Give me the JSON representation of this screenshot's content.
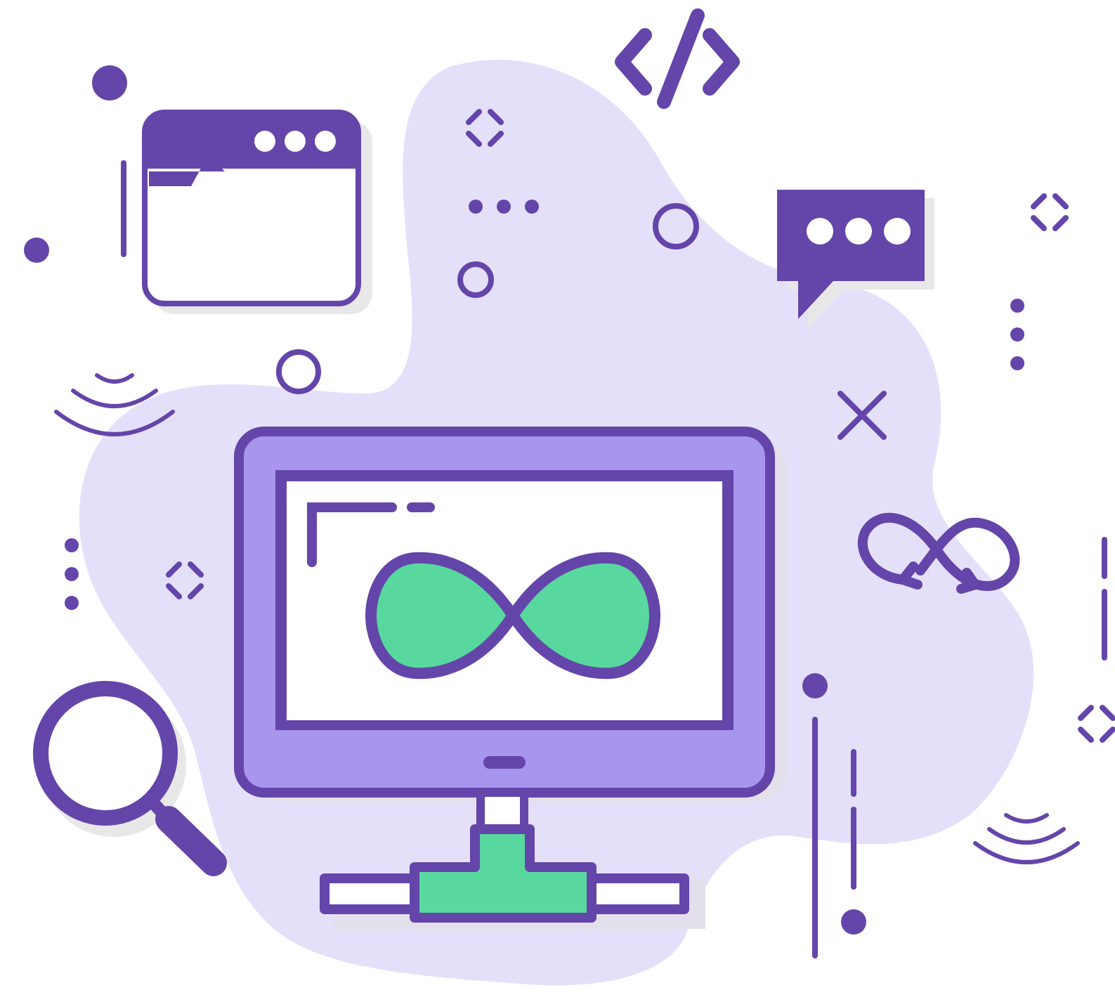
{
  "illustration": {
    "subject": "devops-infinity-monitor",
    "colors": {
      "primary": "#6445AA",
      "monitor_fill": "#A895EE",
      "blob": "#E5E0FA",
      "accent_green": "#58D89E",
      "shadow": "#E8E8E8",
      "background": "#FFFFFF"
    },
    "icons": [
      "code-brackets-icon",
      "browser-window-icon",
      "chat-bubble-icon",
      "infinity-loop-icon",
      "magnifier-icon",
      "desktop-monitor-icon",
      "network-connector-icon",
      "infinity-cycle-arrows-icon",
      "signal-waves-icon",
      "close-cross-icon"
    ]
  }
}
